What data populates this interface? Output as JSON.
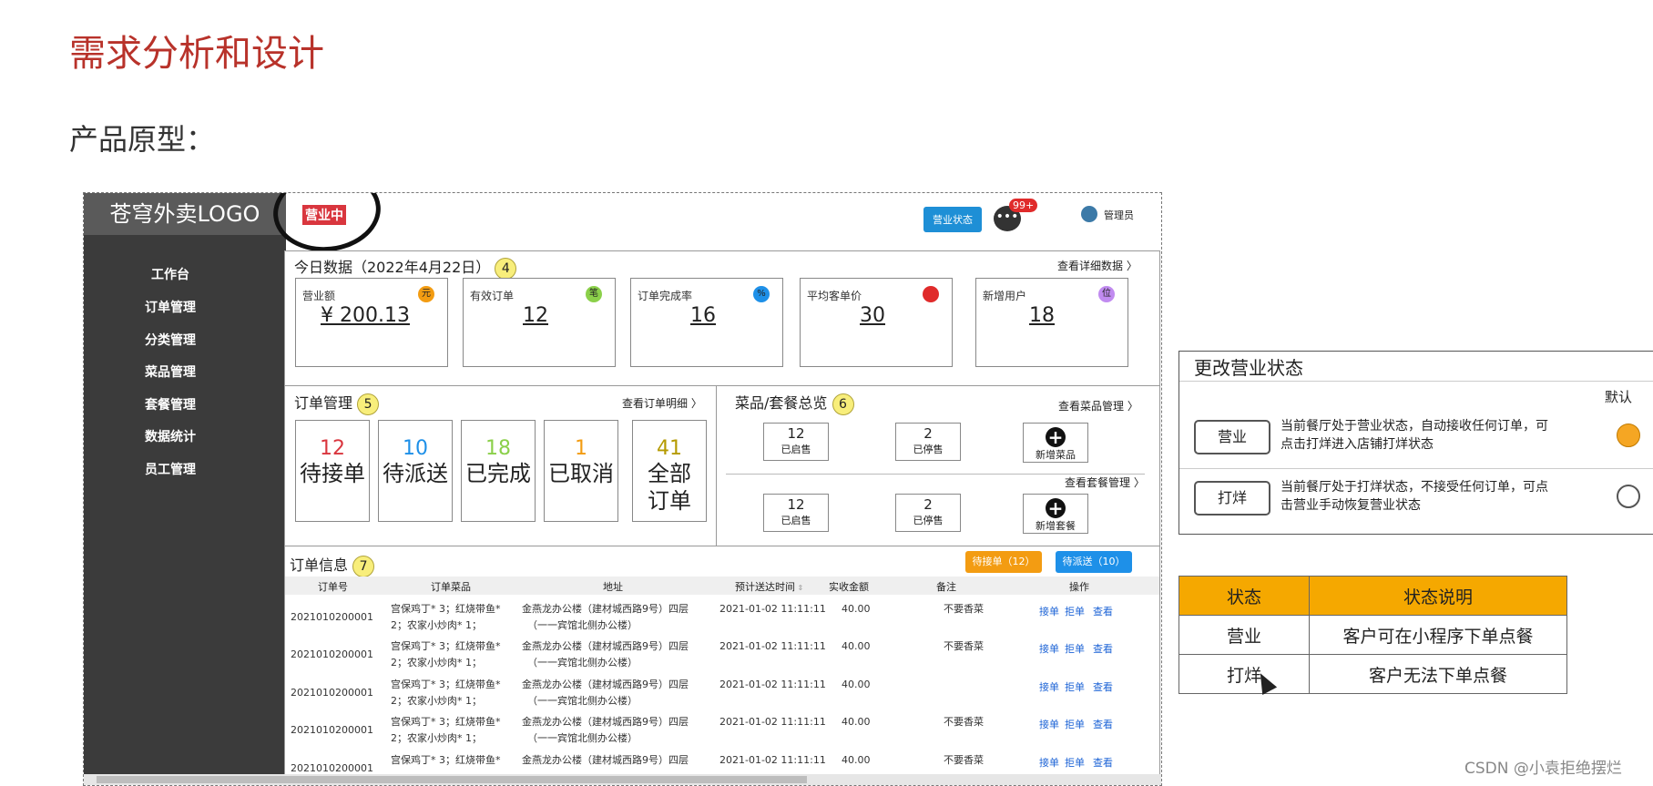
{
  "page": {
    "title": "需求分析和设计",
    "subtitle": "产品原型："
  },
  "app": {
    "logo": "苍穹外卖LOGO",
    "status_chip": "营业中",
    "biz_status_button": "营业状态",
    "msg_badge": "99+",
    "admin": "管理员",
    "nav": [
      "工作台",
      "订单管理",
      "分类管理",
      "菜品管理",
      "套餐管理",
      "数据统计",
      "员工管理"
    ]
  },
  "today": {
    "title": "今日数据（2022年4月22日）",
    "badge": "4",
    "link": "查看详细数据",
    "cards": [
      {
        "label": "营业额",
        "value": "¥ 200.13",
        "icon": "元",
        "icon_color": "#f39c12"
      },
      {
        "label": "有效订单",
        "value": "12",
        "icon": "笔",
        "icon_color": "#8bd04a"
      },
      {
        "label": "订单完成率",
        "value": "16",
        "icon": "%",
        "icon_color": "#1e90e8"
      },
      {
        "label": "平均客单价",
        "value": "30",
        "icon": "",
        "icon_color": "#e02b2b"
      },
      {
        "label": "新增用户",
        "value": "18",
        "icon": "位",
        "icon_color": "#c18bf0"
      }
    ]
  },
  "orders": {
    "title": "订单管理",
    "badge": "5",
    "link": "查看订单明细",
    "boxes": [
      {
        "num": "12",
        "label": "待接单",
        "color": "#d9363e"
      },
      {
        "num": "10",
        "label": "待派送",
        "color": "#1e90e8"
      },
      {
        "num": "18",
        "label": "已完成",
        "color": "#8bd04a"
      },
      {
        "num": "1",
        "label": "已取消",
        "color": "#f39c12"
      },
      {
        "num": "41",
        "label": "全部\n订单",
        "color": "#b59a00"
      }
    ]
  },
  "dishes": {
    "title": "菜品/套餐总览",
    "badge": "6",
    "dish_link": "查看菜品管理",
    "combo_link": "查看套餐管理",
    "dish": {
      "on_num": "12",
      "on": "已启售",
      "off_num": "2",
      "off": "已停售",
      "add": "新增菜品"
    },
    "combo": {
      "on_num": "12",
      "on": "已启售",
      "off_num": "2",
      "off": "已停售",
      "add": "新增套餐"
    }
  },
  "order_info": {
    "title": "订单信息",
    "badge": "7",
    "btn_pending": "待接单（12）",
    "btn_delivery": "待派送（10）",
    "columns": [
      "订单号",
      "订单菜品",
      "地址",
      "预计送达时间",
      "实收金额",
      "备注",
      "操作"
    ],
    "rows": [
      {
        "id": "2021010200001",
        "dish1": "宫保鸡丁* 3；红烧带鱼*",
        "dish2": "2；农家小炒肉* 1；",
        "addr1": "金燕龙办公楼（建材城西路9号）四层",
        "addr2": "（一一宾馆北侧办公楼）",
        "time": "2021-01-02 11:11:11",
        "amount": "40.00",
        "note": "不要香菜"
      },
      {
        "id": "2021010200001",
        "dish1": "宫保鸡丁* 3；红烧带鱼*",
        "dish2": "2；农家小炒肉* 1；",
        "addr1": "金燕龙办公楼（建材城西路9号）四层",
        "addr2": "（一一宾馆北侧办公楼）",
        "time": "2021-01-02 11:11:11",
        "amount": "40.00",
        "note": "不要香菜"
      },
      {
        "id": "2021010200001",
        "dish1": "宫保鸡丁* 3；红烧带鱼*",
        "dish2": "2；农家小炒肉* 1；",
        "addr1": "金燕龙办公楼（建材城西路9号）四层",
        "addr2": "（一一宾馆北侧办公楼）",
        "time": "2021-01-02 11:11:11",
        "amount": "40.00",
        "note": ""
      },
      {
        "id": "2021010200001",
        "dish1": "宫保鸡丁* 3；红烧带鱼*",
        "dish2": "2；农家小炒肉* 1；",
        "addr1": "金燕龙办公楼（建材城西路9号）四层",
        "addr2": "（一一宾馆北侧办公楼）",
        "time": "2021-01-02 11:11:11",
        "amount": "40.00",
        "note": "不要香菜"
      },
      {
        "id": "2021010200001",
        "dish1": "宫保鸡丁* 3；红烧带鱼*",
        "dish2": "",
        "addr1": "金燕龙办公楼（建材城西路9号）四层",
        "addr2": "",
        "time": "2021-01-02 11:11:11",
        "amount": "40.00",
        "note": "不要香菜"
      }
    ],
    "actions": [
      "接单",
      "拒单",
      "查看"
    ]
  },
  "dialog": {
    "title": "更改营业状态",
    "default_label": "默认",
    "open_btn": "营业",
    "open_desc1": "当前餐厅处于营业状态，自动接收任何订单，可",
    "open_desc2": "点击打烊进入店铺打烊状态",
    "close_btn": "打烊",
    "close_desc1": "当前餐厅处于打烊状态，不接受任何订单，可点",
    "close_desc2": "击营业手动恢复营业状态"
  },
  "status_table": {
    "headers": [
      "状态",
      "状态说明"
    ],
    "rows": [
      [
        "营业",
        "客户可在小程序下单点餐"
      ],
      [
        "打烊",
        "客户无法下单点餐"
      ]
    ]
  },
  "watermark": "CSDN @小袁拒绝摆烂"
}
